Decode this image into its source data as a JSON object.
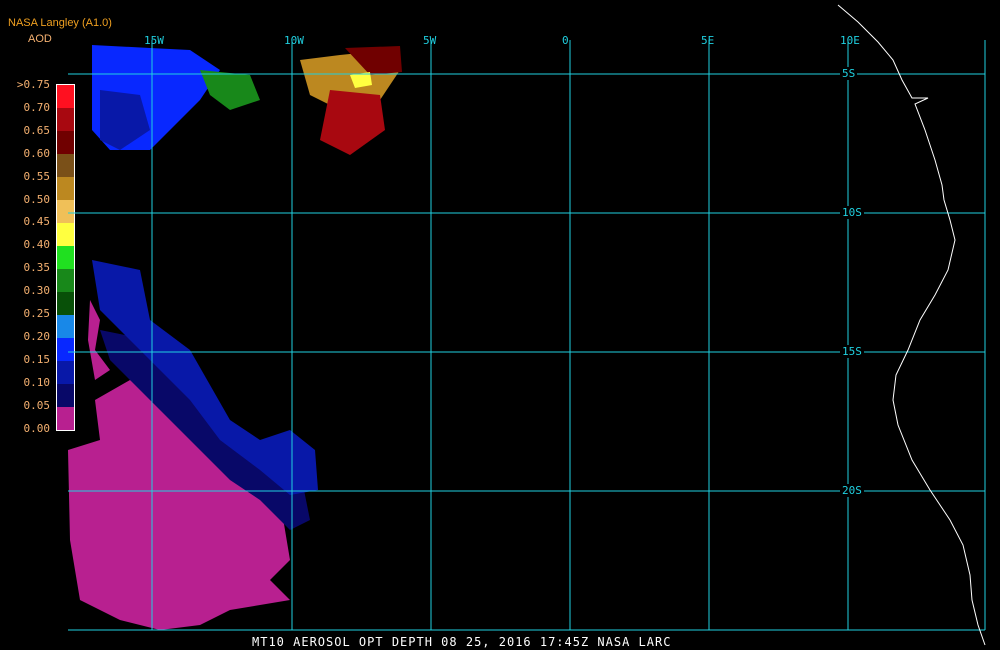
{
  "header": {
    "source": "NASA Langley (A1.0)",
    "variable": "AOD"
  },
  "legend": {
    "labels": [
      ">0.75",
      "0.70",
      "0.65",
      "0.60",
      "0.55",
      "0.50",
      "0.45",
      "0.40",
      "0.35",
      "0.30",
      "0.25",
      "0.20",
      "0.15",
      "0.10",
      "0.05",
      "0.00"
    ],
    "colors": [
      "#ff1020",
      "#a80810",
      "#700000",
      "#7a5018",
      "#bc8820",
      "#f0c058",
      "#ffff40",
      "#20e020",
      "#18881a",
      "#085008",
      "#1888e8",
      "#0828ff",
      "#0818a8",
      "#080868",
      "#b82090"
    ]
  },
  "grid": {
    "longitudes": [
      "15W",
      "10W",
      "5W",
      "0",
      "5E",
      "10E"
    ],
    "latitudes": [
      "5S",
      "10S",
      "15S",
      "20S"
    ],
    "color": "#20d0e0"
  },
  "caption": "MT10  AEROSOL OPT DEPTH   08 25, 2016 17:45Z   NASA LARC"
}
